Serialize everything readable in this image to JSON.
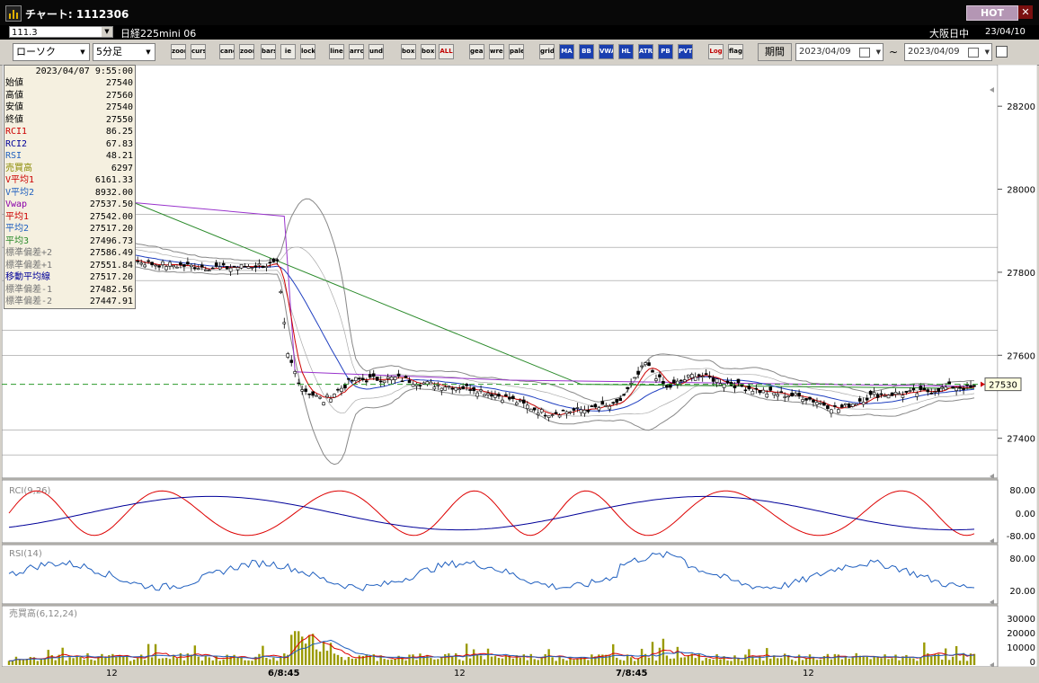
{
  "window": {
    "title": "チャート: 1112306",
    "hot_label": "HOT",
    "close_label": "✕"
  },
  "header": {
    "symbol": "111.3",
    "instrument": "日経225mini 06",
    "market": "大阪日中",
    "date": "23/04/10"
  },
  "toolbar": {
    "chart_type": "ローソク",
    "interval": "5分足",
    "buttons": [
      "zoom",
      "cursor",
      "candle",
      "zoom-in",
      "bars",
      "ie",
      "lock",
      "line",
      "arrow",
      "undo",
      "box-left",
      "box-right",
      "ALL",
      "gear",
      "wrench",
      "palette",
      "grid",
      "MA",
      "BB",
      "VWAP",
      "HL",
      "ATR",
      "PB",
      "PVT",
      "Log",
      "flag"
    ],
    "period_label": "期間",
    "date_from": "2023/04/09",
    "date_to": "2023/04/09",
    "tilde": "~"
  },
  "info_panel": {
    "timestamp": "2023/04/07  9:55:00",
    "rows": [
      {
        "label": "始値",
        "value": "27540",
        "color": "#000000"
      },
      {
        "label": "高値",
        "value": "27560",
        "color": "#000000"
      },
      {
        "label": "安値",
        "value": "27540",
        "color": "#000000"
      },
      {
        "label": "終値",
        "value": "27550",
        "color": "#000000"
      },
      {
        "label": "RCI1",
        "value": "86.25",
        "color": "#cc0000"
      },
      {
        "label": "RCI2",
        "value": "67.83",
        "color": "#000099"
      },
      {
        "label": "RSI",
        "value": "48.21",
        "color": "#1f5fbf"
      },
      {
        "label": "売買高",
        "value": "6297",
        "color": "#8a8a00"
      },
      {
        "label": "V平均1",
        "value": "6161.33",
        "color": "#cc0000"
      },
      {
        "label": "V平均2",
        "value": "8932.00",
        "color": "#1f5fbf"
      },
      {
        "label": "Vwap",
        "value": "27537.50",
        "color": "#8a00aa"
      },
      {
        "label": "平均1",
        "value": "27542.00",
        "color": "#cc0000"
      },
      {
        "label": "平均2",
        "value": "27517.20",
        "color": "#1f5fbf"
      },
      {
        "label": "平均3",
        "value": "27496.73",
        "color": "#2a8a2a"
      },
      {
        "label": "標準偏差+2",
        "value": "27586.49",
        "color": "#777777"
      },
      {
        "label": "標準偏差+1",
        "value": "27551.84",
        "color": "#777777"
      },
      {
        "label": "移動平均線",
        "value": "27517.20",
        "color": "#000099"
      },
      {
        "label": "標準偏差-1",
        "value": "27482.56",
        "color": "#777777"
      },
      {
        "label": "標準偏差-2",
        "value": "27447.91",
        "color": "#777777"
      }
    ]
  },
  "chart_data": [
    {
      "type": "candlestick",
      "ylim": [
        27330,
        28300
      ],
      "yticks": [
        "28200",
        "28000",
        "27800",
        "27600",
        "27400"
      ],
      "last_price_label": "27530",
      "xticks": [
        "12",
        "6/8:45",
        "12",
        "7/8:45",
        "12"
      ],
      "anchors": [
        [
          0,
          27900
        ],
        [
          20,
          27850
        ],
        [
          40,
          27820
        ],
        [
          60,
          27810
        ],
        [
          75,
          27820
        ],
        [
          78,
          27600
        ],
        [
          82,
          27520
        ],
        [
          88,
          27490
        ],
        [
          96,
          27540
        ],
        [
          108,
          27545
        ],
        [
          118,
          27530
        ],
        [
          130,
          27520
        ],
        [
          140,
          27495
        ],
        [
          150,
          27460
        ],
        [
          162,
          27470
        ],
        [
          170,
          27480
        ],
        [
          175,
          27540
        ],
        [
          178,
          27580
        ],
        [
          184,
          27520
        ],
        [
          192,
          27555
        ],
        [
          200,
          27535
        ],
        [
          212,
          27510
        ],
        [
          222,
          27500
        ],
        [
          232,
          27470
        ],
        [
          242,
          27505
        ],
        [
          255,
          27510
        ],
        [
          264,
          27525
        ],
        [
          270,
          27520
        ]
      ],
      "colors": {
        "ma1": "#cc0000",
        "ma2": "#1f3fc0",
        "ma3": "#2a8a2a",
        "vwap": "#9933cc",
        "band": "#888888",
        "dash": "#2a9a2a"
      }
    },
    {
      "type": "line",
      "title": "RCI(9,26)",
      "yticks": [
        "80.00",
        "0.00",
        "-80.00"
      ],
      "ylim": [
        -100,
        100
      ]
    },
    {
      "type": "line",
      "title": "RSI(14)",
      "yticks": [
        "80.00",
        "20.00"
      ],
      "ylim": [
        0,
        100
      ]
    },
    {
      "type": "bar",
      "title": "売買高(6,12,24)",
      "yticks": [
        "30000",
        "20000",
        "10000",
        "0"
      ],
      "ylim": [
        0,
        35000
      ]
    }
  ]
}
